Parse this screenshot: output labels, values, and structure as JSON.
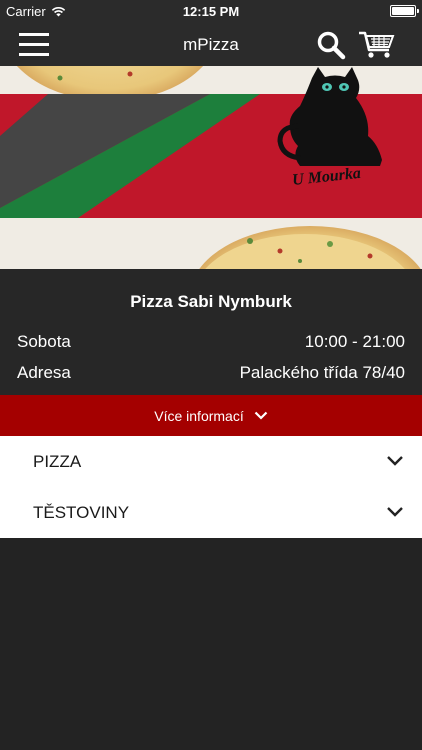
{
  "status_bar": {
    "carrier": "Carrier",
    "time": "12:15 PM",
    "battery_level": 1.0
  },
  "nav": {
    "title": "mPizza"
  },
  "hero": {
    "logo_text": "U Mourka"
  },
  "info": {
    "restaurant_name": "Pizza Sabi Nymburk",
    "day_label": "Sobota",
    "hours": "10:00 - 21:00",
    "address_label": "Adresa",
    "address": "Palackého třída 78/40"
  },
  "more_info": {
    "label": "Více informací"
  },
  "categories": [
    {
      "label": "PIZZA"
    },
    {
      "label": "TĚSTOVINY"
    }
  ],
  "colors": {
    "accent": "#a40000",
    "bar": "#2b2b2b",
    "background": "#232323"
  }
}
